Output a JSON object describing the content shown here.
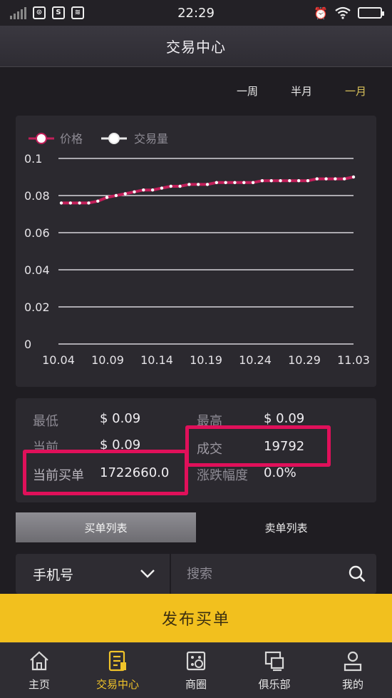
{
  "status_bar": {
    "time": "22:29"
  },
  "header": {
    "title": "交易中心"
  },
  "period_tabs": [
    {
      "label": "一周",
      "active": false
    },
    {
      "label": "半月",
      "active": false
    },
    {
      "label": "一月",
      "active": true
    }
  ],
  "chart_data": {
    "type": "line",
    "legend": [
      "价格",
      "交易量"
    ],
    "legend_placement": "top-left",
    "x_ticks": [
      "10.04",
      "10.09",
      "10.14",
      "10.19",
      "10.24",
      "10.29",
      "11.03"
    ],
    "y_ticks": [
      "0",
      "0.02",
      "0.04",
      "0.06",
      "0.08",
      "0.1"
    ],
    "ylim": [
      0,
      0.1
    ],
    "grid": true,
    "series": [
      {
        "name": "价格",
        "color": "#c21f5a",
        "values": [
          0.076,
          0.076,
          0.076,
          0.076,
          0.077,
          0.079,
          0.08,
          0.081,
          0.082,
          0.083,
          0.083,
          0.084,
          0.085,
          0.085,
          0.086,
          0.086,
          0.086,
          0.087,
          0.087,
          0.087,
          0.087,
          0.087,
          0.088,
          0.088,
          0.088,
          0.088,
          0.088,
          0.088,
          0.089,
          0.089,
          0.089,
          0.089,
          0.09
        ]
      }
    ]
  },
  "stats": {
    "lowest_label": "最低",
    "lowest_value": "$ 0.09",
    "highest_label": "最高",
    "highest_value": "$ 0.09",
    "current_label": "当前",
    "current_value": "$ 0.09",
    "deal_label": "成交",
    "deal_value": "19792",
    "buy_orders_label": "当前买单",
    "buy_orders_value": "1722660.0",
    "change_label": "涨跌幅度",
    "change_value": "0.0%"
  },
  "list_tabs": [
    {
      "label": "买单列表",
      "active": true
    },
    {
      "label": "卖单列表",
      "active": false
    }
  ],
  "search": {
    "select_value": "手机号",
    "placeholder": "搜索"
  },
  "publish_button": {
    "label": "发布买单"
  },
  "bottom_nav": [
    {
      "label": "主页",
      "icon": "home-icon",
      "active": false
    },
    {
      "label": "交易中心",
      "icon": "trade-icon",
      "active": true
    },
    {
      "label": "商圈",
      "icon": "shop-icon",
      "active": false
    },
    {
      "label": "俱乐部",
      "icon": "club-icon",
      "active": false
    },
    {
      "label": "我的",
      "icon": "profile-icon",
      "active": false
    }
  ],
  "colors": {
    "accent": "#f2c01e",
    "highlight": "#e0105a",
    "active_nav": "#f1c42a",
    "active_period": "#d8c15a"
  }
}
